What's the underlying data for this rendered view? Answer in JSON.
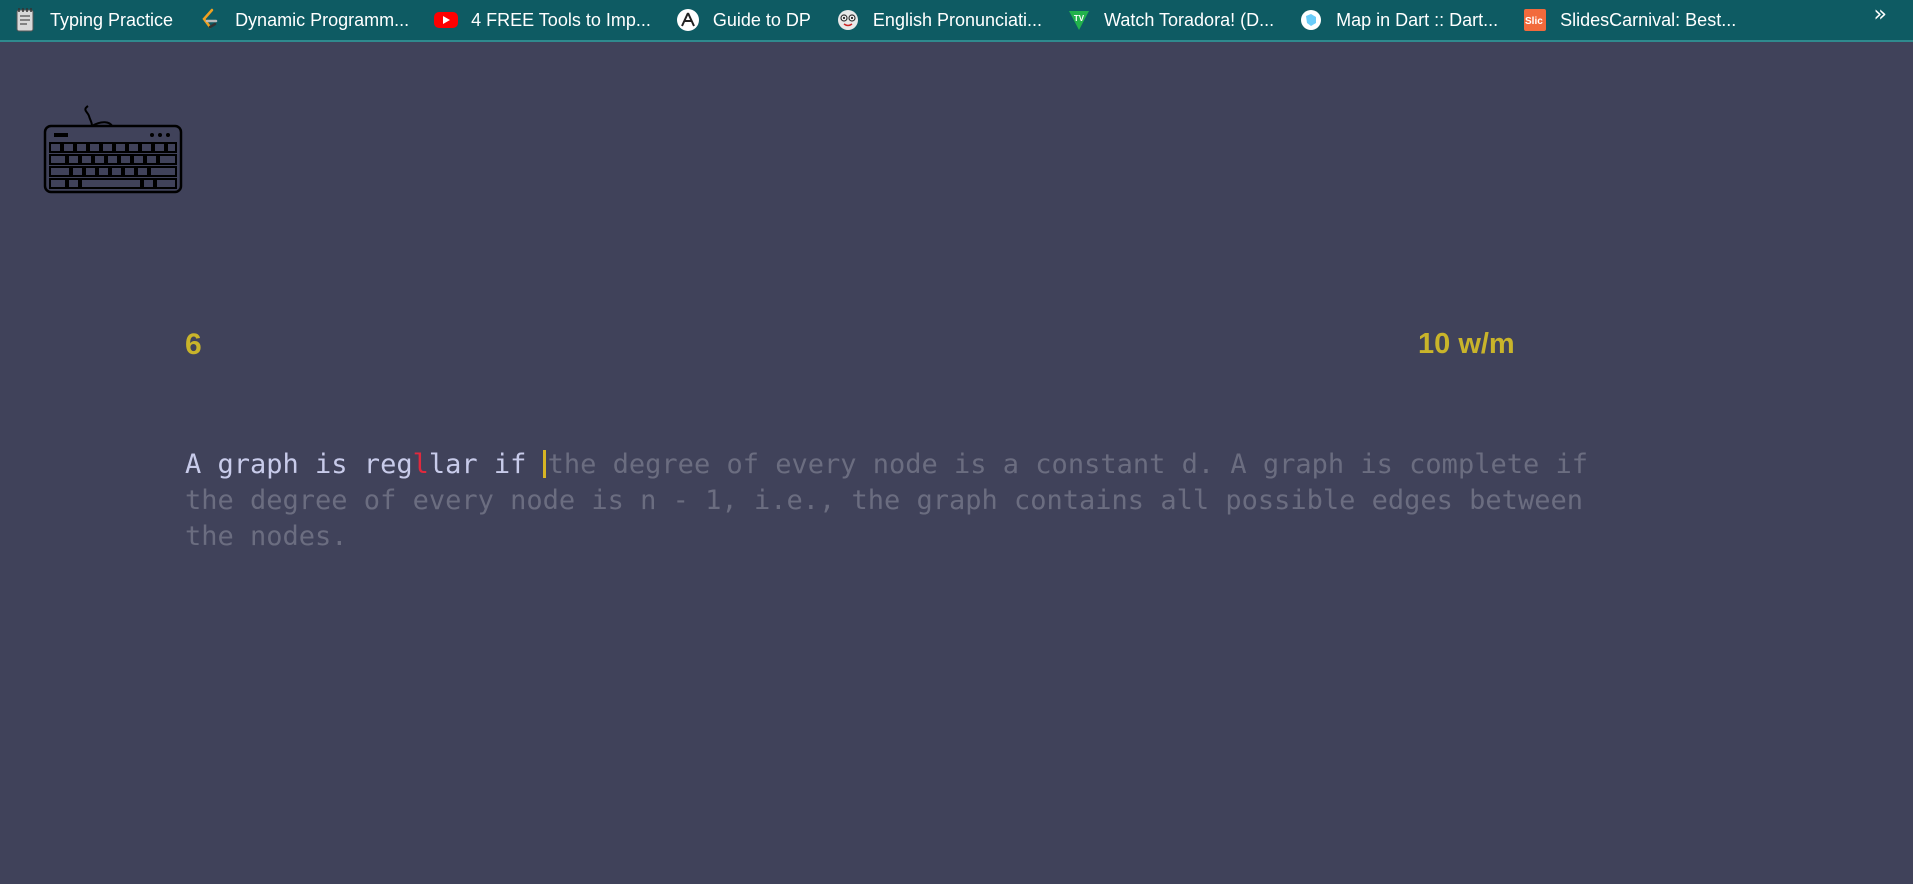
{
  "bookmarks": [
    {
      "label": "Typing Practice",
      "icon": "notebook-icon"
    },
    {
      "label": "Dynamic Programm...",
      "icon": "leetcode-icon"
    },
    {
      "label": "4 FREE Tools to Imp...",
      "icon": "youtube-icon"
    },
    {
      "label": "Guide to DP",
      "icon": "atcoder-icon"
    },
    {
      "label": "English Pronunciati...",
      "icon": "face-icon"
    },
    {
      "label": "Watch Toradora! (D...",
      "icon": "tv-icon"
    },
    {
      "label": "Map in Dart :: Dart...",
      "icon": "dart-icon"
    },
    {
      "label": "SlidesCarnival: Best...",
      "icon": "slidescarnival-icon"
    }
  ],
  "overflow_label": "»",
  "app": {
    "counter": "6",
    "wpm": "10 w/m"
  },
  "passage": {
    "typed_before_error": "A graph is reg",
    "error_char": "l",
    "typed_after_error": "lar if ",
    "remaining": "the degree of every node is a constant d. A graph is complete if the degree of every node is n - 1, i.e., the graph contains all possible edges between the nodes."
  },
  "colors": {
    "bookmarks_bg": "#0e5b63",
    "page_bg": "#40425a",
    "accent": "#c9b42a",
    "typed_text": "#c8cbea",
    "error_text": "#e0293d",
    "pending_text": "#6b6d80"
  }
}
